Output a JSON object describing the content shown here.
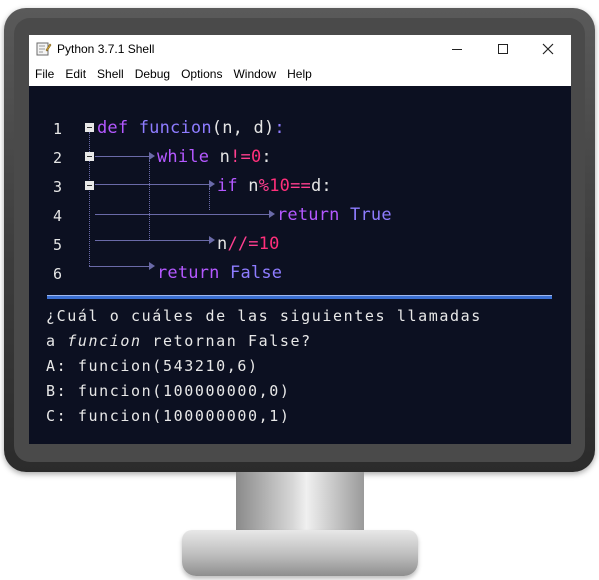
{
  "window": {
    "title": "Python 3.7.1 Shell",
    "controls": {
      "minimize": "—",
      "maximize": "☐",
      "close": "✕"
    }
  },
  "menu": [
    "File",
    "Edit",
    "Shell",
    "Debug",
    "Options",
    "Window",
    "Help"
  ],
  "code": {
    "line_numbers": [
      "1",
      "2",
      "3",
      "4",
      "5",
      "6"
    ],
    "lines": [
      {
        "tokens": [
          [
            "kw",
            "def"
          ],
          [
            "plain",
            " "
          ],
          [
            "fn",
            "funcion"
          ],
          [
            "plain",
            "(n, d)"
          ],
          [
            "fn",
            ":"
          ]
        ]
      },
      {
        "tokens": [
          [
            "kw",
            "while"
          ],
          [
            "plain",
            " n"
          ],
          [
            "op",
            "!="
          ],
          [
            "num",
            "0"
          ],
          [
            "plain",
            ":"
          ]
        ]
      },
      {
        "tokens": [
          [
            "kw",
            "if"
          ],
          [
            "plain",
            " n"
          ],
          [
            "op",
            "%"
          ],
          [
            "num",
            "10"
          ],
          [
            "op",
            "=="
          ],
          [
            "plain",
            "d:"
          ]
        ]
      },
      {
        "tokens": [
          [
            "kw",
            "return"
          ],
          [
            "plain",
            " "
          ],
          [
            "fn",
            "True"
          ]
        ]
      },
      {
        "tokens": [
          [
            "plain",
            "n"
          ],
          [
            "op",
            "//="
          ],
          [
            "num",
            "10"
          ]
        ]
      },
      {
        "tokens": [
          [
            "kw",
            "return"
          ],
          [
            "plain",
            " "
          ],
          [
            "fn",
            "False"
          ]
        ]
      }
    ]
  },
  "question": {
    "line1": "¿Cuál o cuáles de las siguientes llamadas",
    "line2_prefix": "a ",
    "line2_em": "funcion",
    "line2_suffix": " retornan False?",
    "options": [
      "A: funcion(543210,6)",
      "B: funcion(100000000,0)",
      "C: funcion(100000000,1)"
    ]
  },
  "colors": {
    "shell_background": "#0c1021",
    "keyword": "#b458ff",
    "function": "#8e7cff",
    "number": "#ff2f7a",
    "separator": "#3b6fd1"
  },
  "icons": {
    "app": "python-idle-icon"
  }
}
